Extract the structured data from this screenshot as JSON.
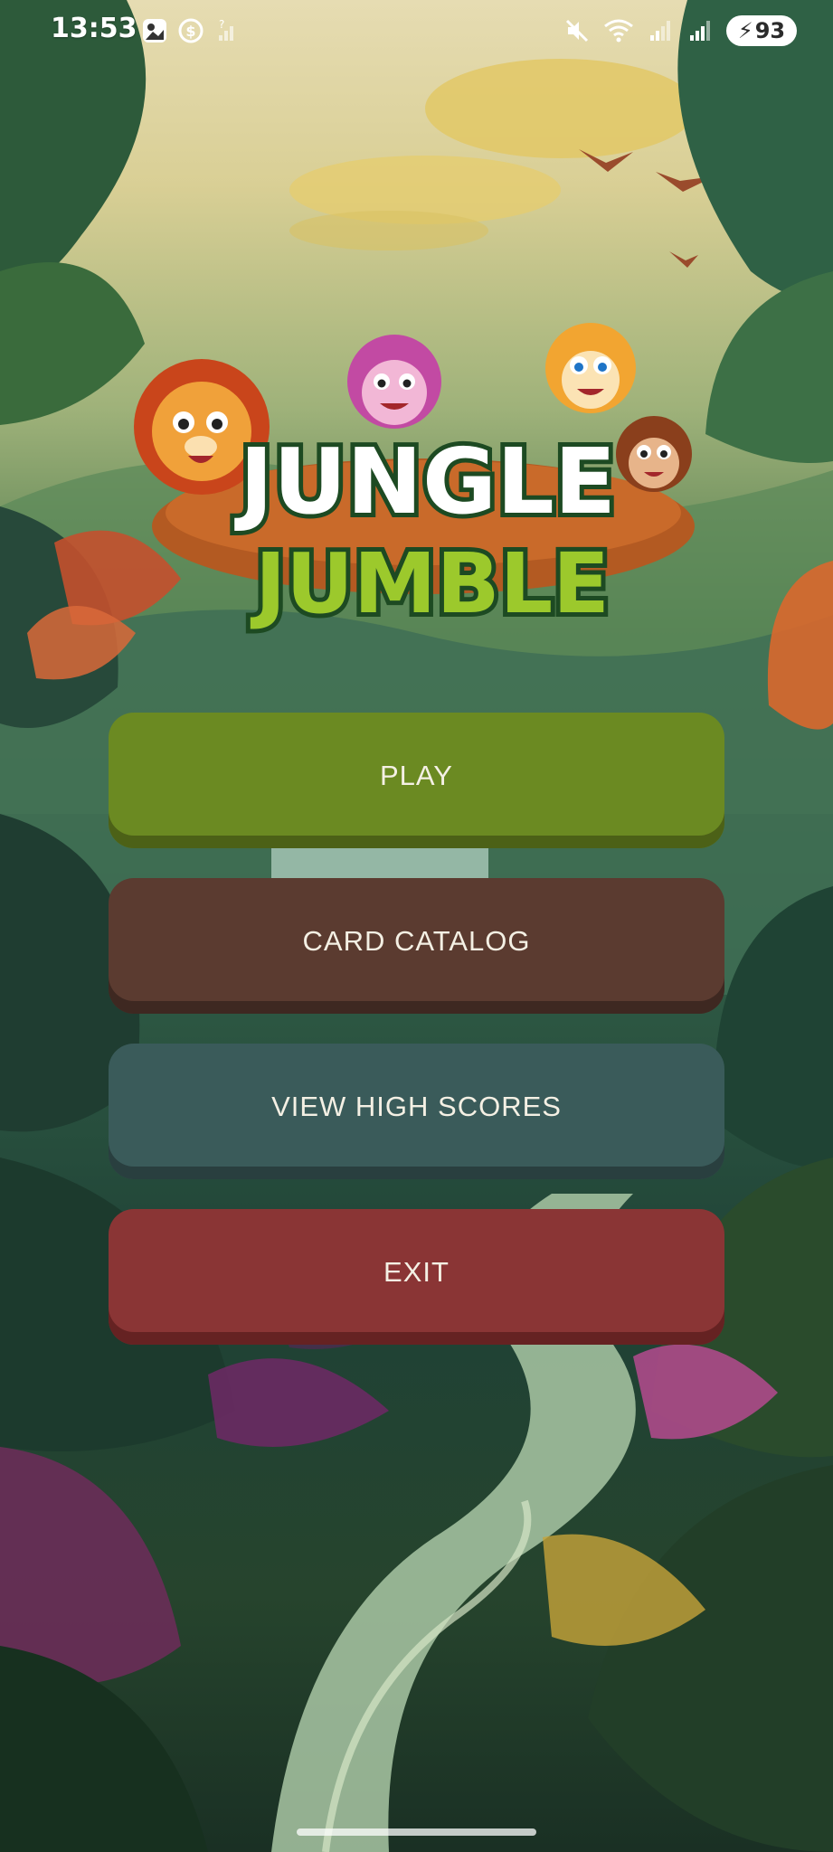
{
  "status_bar": {
    "time": "13:53",
    "battery": "93",
    "icons": [
      "gallery-icon",
      "data-saver-icon",
      "no-signal-icon",
      "mute-icon",
      "wifi-icon",
      "signal-icon",
      "signal-icon-2",
      "battery-icon"
    ]
  },
  "logo": {
    "line1": "JUNGLE",
    "line2": "JUMBLE"
  },
  "menu": {
    "play": "PLAY",
    "catalog": "CARD CATALOG",
    "high_scores": "VIEW HIGH SCORES",
    "exit": "EXIT"
  },
  "colors": {
    "play": "#6b8a22",
    "catalog": "#5b3b30",
    "high_scores": "#3a5b5a",
    "exit": "#8a3535",
    "button_text": "#f4f0e4"
  }
}
